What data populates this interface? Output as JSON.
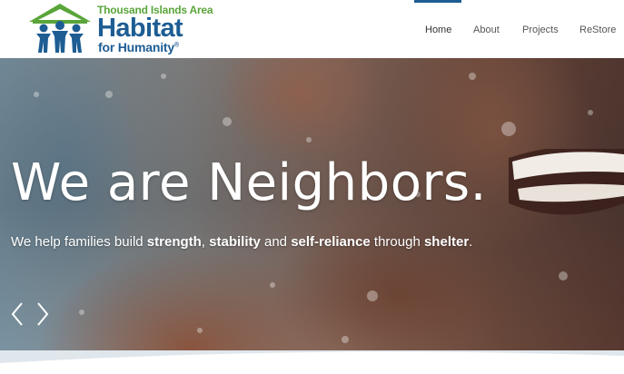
{
  "logo": {
    "area": "Thousand Islands Area",
    "name": "Habitat",
    "sub": "for Humanity",
    "reg": "®",
    "colors": {
      "green": "#5aa53a",
      "blue": "#1d5d93"
    }
  },
  "nav": {
    "items": [
      {
        "label": "Home",
        "active": true
      },
      {
        "label": "About",
        "active": false
      },
      {
        "label": "Projects",
        "active": false
      },
      {
        "label": "ReStore",
        "active": false
      }
    ]
  },
  "hero": {
    "headline": "We are Neighbors.",
    "tagline": {
      "t1": "We help families build ",
      "b1": "strength",
      "t2": ", ",
      "b2": "stability",
      "t3": " and ",
      "b3": "self-reliance",
      "t4": " through ",
      "b4": "shelter",
      "t5": "."
    },
    "prev_icon": "chevron-left-icon",
    "next_icon": "chevron-right-icon"
  }
}
